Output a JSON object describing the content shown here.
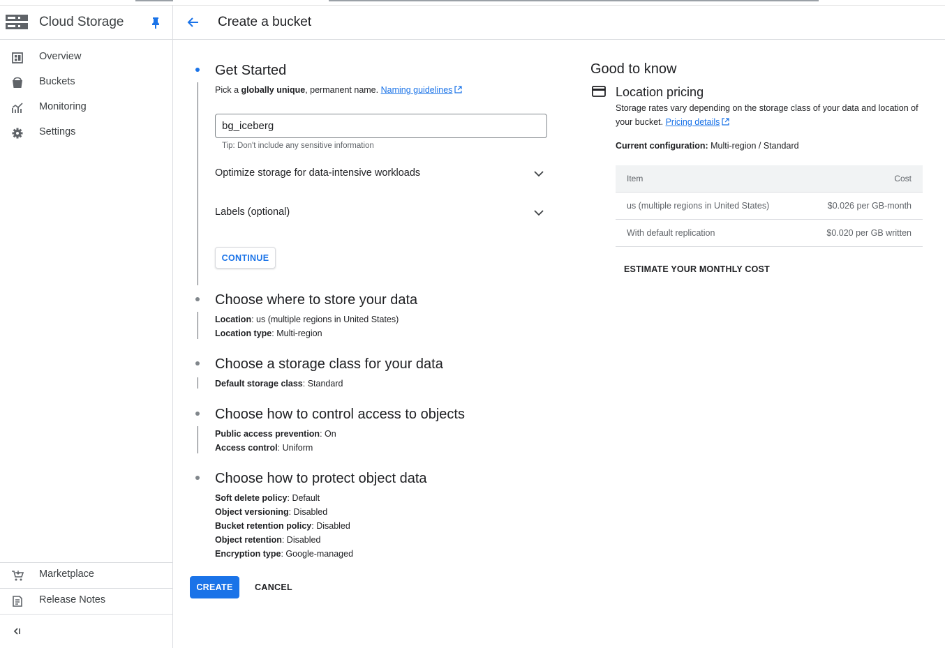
{
  "sidebar": {
    "title": "Cloud Storage",
    "nav": [
      {
        "label": "Overview",
        "icon": "overview-icon"
      },
      {
        "label": "Buckets",
        "icon": "bucket-icon"
      },
      {
        "label": "Monitoring",
        "icon": "monitoring-icon"
      },
      {
        "label": "Settings",
        "icon": "gear-icon"
      }
    ],
    "bottom_nav": [
      {
        "label": "Marketplace",
        "icon": "cart-icon"
      },
      {
        "label": "Release Notes",
        "icon": "release-notes-icon"
      }
    ]
  },
  "header": {
    "title": "Create a bucket"
  },
  "get_started": {
    "title": "Get Started",
    "pick_prefix": "Pick a ",
    "pick_bold": "globally unique",
    "pick_suffix": ", permanent name. ",
    "naming_link": "Naming guidelines",
    "name_value": "bg_iceberg",
    "tip": "Tip: Don't include any sensitive information",
    "optimize_label": "Optimize storage for data-intensive workloads",
    "labels_label": "Labels (optional)",
    "continue_label": "CONTINUE"
  },
  "steps": [
    {
      "title": "Choose where to store your data",
      "lines": [
        {
          "key": "Location",
          "value": "us (multiple regions in United States)"
        },
        {
          "key": "Location type",
          "value": "Multi-region"
        }
      ]
    },
    {
      "title": "Choose a storage class for your data",
      "lines": [
        {
          "key": "Default storage class",
          "value": "Standard"
        }
      ]
    },
    {
      "title": "Choose how to control access to objects",
      "lines": [
        {
          "key": "Public access prevention",
          "value": "On"
        },
        {
          "key": "Access control",
          "value": "Uniform"
        }
      ]
    },
    {
      "title": "Choose how to protect object data",
      "lines": [
        {
          "key": "Soft delete policy",
          "value": "Default"
        },
        {
          "key": "Object versioning",
          "value": "Disabled"
        },
        {
          "key": "Bucket retention policy",
          "value": "Disabled"
        },
        {
          "key": "Object retention",
          "value": "Disabled"
        },
        {
          "key": "Encryption type",
          "value": "Google-managed"
        }
      ]
    }
  ],
  "actions": {
    "create_label": "CREATE",
    "cancel_label": "CANCEL"
  },
  "good_to_know": {
    "title": "Good to know",
    "location_pricing_title": "Location pricing",
    "desc_text": "Storage rates vary depending on the storage class of your data and location of your bucket. ",
    "pricing_link": "Pricing details",
    "config_label": "Current configuration:",
    "config_value": " Multi-region / Standard",
    "table": {
      "headers": [
        "Item",
        "Cost"
      ],
      "rows": [
        [
          "us (multiple regions in United States)",
          "$0.026 per GB-month"
        ],
        [
          "With default replication",
          "$0.020 per GB written"
        ]
      ]
    },
    "estimate_label": "ESTIMATE YOUR MONTHLY COST"
  },
  "colors": {
    "accent": "#1a73e8",
    "text": "#202124",
    "muted": "#5f6368",
    "divider": "#dadce0"
  }
}
